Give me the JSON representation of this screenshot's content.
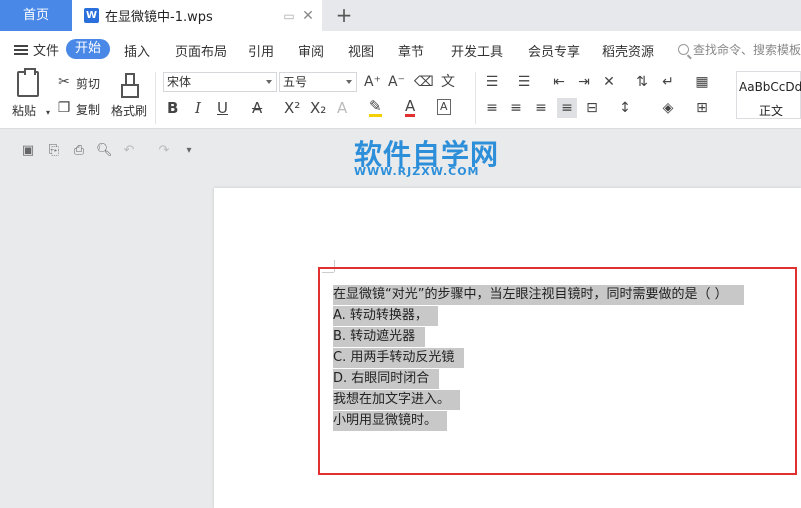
{
  "tabs": {
    "home": "首页",
    "doc_icon": "W",
    "doc_name": "在显微镜中-1.wps",
    "add": "+"
  },
  "menu": {
    "file": "文件",
    "start": "开始",
    "items": [
      "插入",
      "页面布局",
      "引用",
      "审阅",
      "视图",
      "章节",
      "开发工具",
      "会员专享",
      "稻壳资源"
    ],
    "search_placeholder": "查找命令、搜索模板"
  },
  "ribbon": {
    "paste": "粘贴",
    "cut": "剪切",
    "copy": "复制",
    "format_painter": "格式刷",
    "font_name": "宋体",
    "font_size": "五号",
    "style_sample": "AaBbCcDd",
    "style_name": "正文"
  },
  "watermark": {
    "title": "软件自学网",
    "sub": "WWW.RJZXW.COM"
  },
  "document": {
    "lines": [
      "在显微镜“对光”的步骤中，当左眼注视目镜时，同时需要做的是（    ）",
      "A.  转动转换器，",
      "B.  转动遮光器",
      "C.  用两手转动反光镜",
      "D.  右眼同时闭合",
      "我想在加文字进入。",
      "小明用显微镜时。"
    ]
  },
  "colors": {
    "accent": "#4a88e8",
    "selection": "#c8c8c8",
    "highlight_box": "#e03030",
    "watermark": "#2d8fd9"
  }
}
